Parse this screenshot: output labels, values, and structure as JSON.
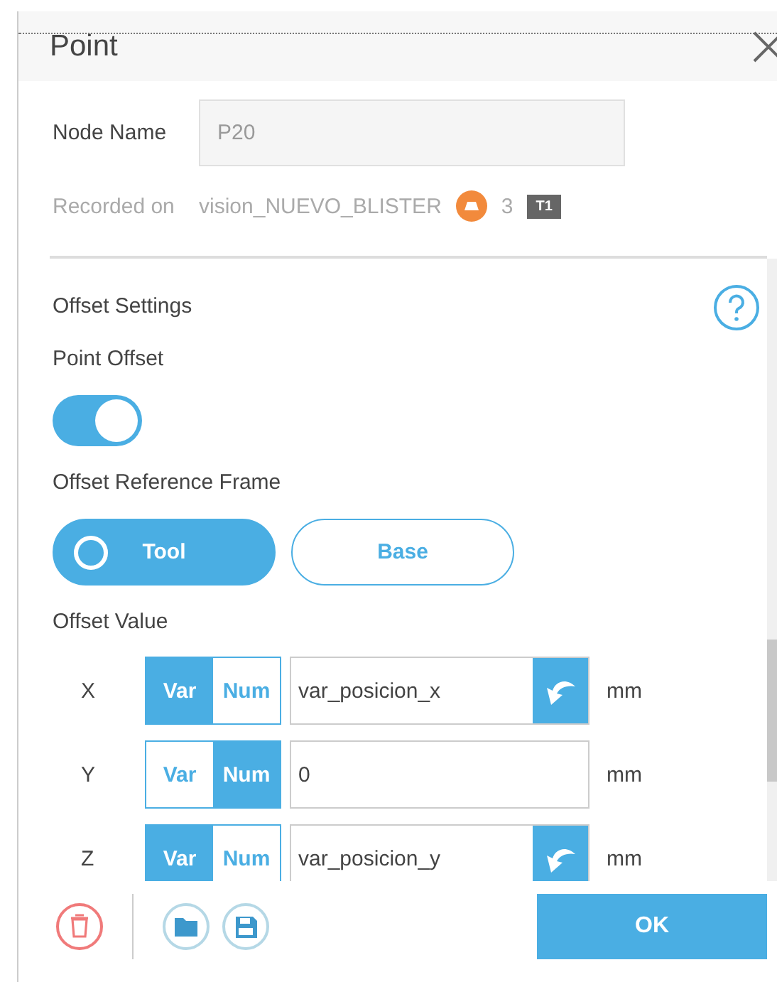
{
  "window": {
    "title": "Point"
  },
  "node_name": {
    "label": "Node Name",
    "value": "P20"
  },
  "recorded": {
    "label": "Recorded on",
    "source": "vision_NUEVO_BLISTER",
    "count": "3",
    "tag": "T1"
  },
  "offset_settings": {
    "heading": "Offset Settings",
    "point_offset": {
      "label": "Point Offset",
      "on": true
    },
    "reference_frame": {
      "label": "Offset Reference Frame",
      "options": [
        {
          "label": "Tool",
          "selected": true
        },
        {
          "label": "Base",
          "selected": false
        }
      ]
    },
    "offset_value": {
      "label": "Offset Value",
      "rows": [
        {
          "axis": "X",
          "modes": [
            {
              "label": "Var",
              "selected": true
            },
            {
              "label": "Num",
              "selected": false
            }
          ],
          "value": "var_posicion_x",
          "unit": "mm"
        },
        {
          "axis": "Y",
          "modes": [
            {
              "label": "Var",
              "selected": false
            },
            {
              "label": "Num",
              "selected": true
            }
          ],
          "value": "0",
          "unit": "mm"
        },
        {
          "axis": "Z",
          "modes": [
            {
              "label": "Var",
              "selected": true
            },
            {
              "label": "Num",
              "selected": false
            }
          ],
          "value": "var_posicion_y",
          "unit": "mm"
        }
      ]
    }
  },
  "buttons": {
    "ok": "OK"
  }
}
